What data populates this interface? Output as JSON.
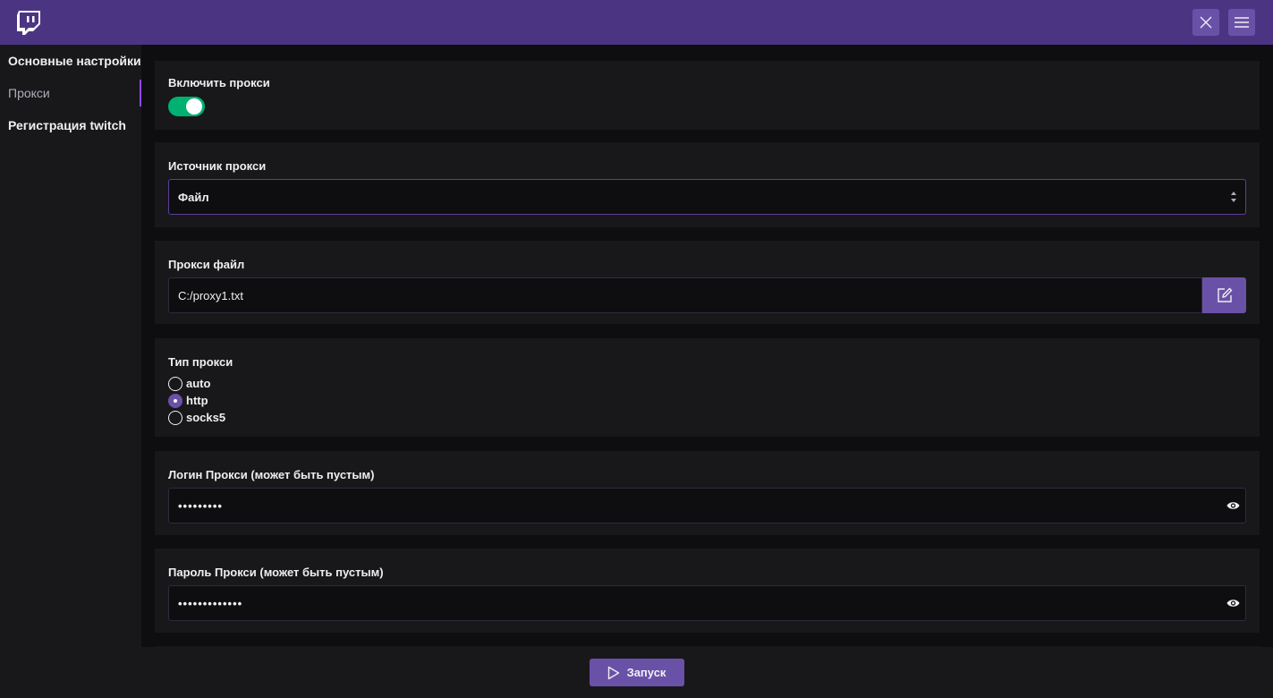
{
  "app": {
    "logo_icon": "twitch-logo-icon"
  },
  "header": {
    "close_icon": "close-icon",
    "menu_icon": "menu-icon"
  },
  "sidebar": {
    "items": [
      {
        "label": "Основные настройки",
        "active": false
      },
      {
        "label": "Прокси",
        "active": true
      },
      {
        "label": "Регистрация twitch",
        "active": false
      }
    ]
  },
  "proxy": {
    "enable": {
      "label": "Включить прокси",
      "value": true
    },
    "source": {
      "label": "Источник прокси",
      "value": "Файл"
    },
    "file": {
      "label": "Прокси файл",
      "value": "C:/proxy1.txt"
    },
    "type": {
      "label": "Тип прокси",
      "options": [
        "auto",
        "http",
        "socks5"
      ],
      "selected": "http"
    },
    "login": {
      "label": "Логин Прокси (может быть пустым)",
      "value": "•••••••••"
    },
    "password": {
      "label": "Пароль Прокси (может быть пустым)",
      "value": "•••••••••••••"
    }
  },
  "footer": {
    "launch_label": "Запуск"
  },
  "colors": {
    "accent": "#6a51a8",
    "header": "#4b3583",
    "toggle_on": "#00b171",
    "panel": "#18181b",
    "background": "#0e0e10"
  }
}
